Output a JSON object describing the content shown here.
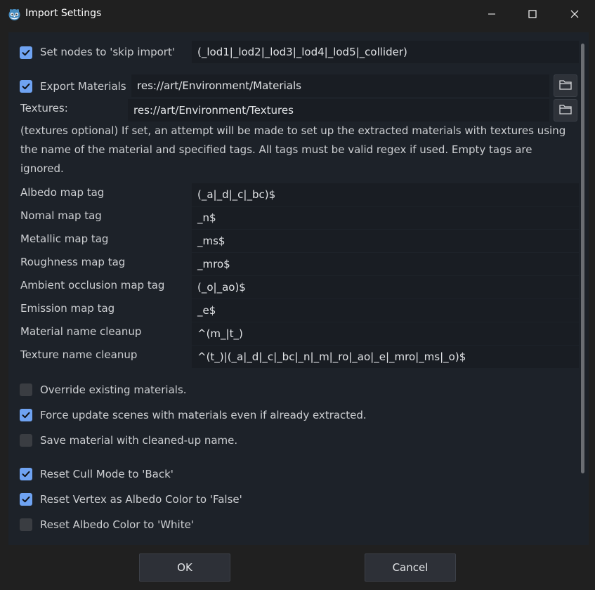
{
  "window": {
    "title": "Import Settings",
    "icon": "godot-icon",
    "controls": [
      "minimize-icon",
      "maximize-icon",
      "close-icon"
    ]
  },
  "skip_import": {
    "checked": true,
    "label": "Set nodes to 'skip import'",
    "value": "(_lod1|_lod2|_lod3|_lod4|_lod5|_collider)"
  },
  "export_materials": {
    "checked": true,
    "label": "Export Materials",
    "path": "res://art/Environment/Materials"
  },
  "textures": {
    "label": "Textures:",
    "path": "res://art/Environment/Textures"
  },
  "description": "(textures optional) If set, an attempt will be made to set up the extracted materials with textures using the name of the material and specified tags. All tags must be valid regex if used. Empty tags are ignored.",
  "tags": [
    {
      "label": "Albedo map tag",
      "value": "(_a|_d|_c|_bc)$"
    },
    {
      "label": "Nomal map tag",
      "value": "_n$"
    },
    {
      "label": "Metallic map tag",
      "value": "_ms$"
    },
    {
      "label": "Roughness map tag",
      "value": "_mro$"
    },
    {
      "label": "Ambient occlusion map tag",
      "value": "(_o|_ao)$"
    },
    {
      "label": "Emission map tag",
      "value": "_e$"
    },
    {
      "label": "Material name cleanup",
      "value": "^(m_|t_)"
    },
    {
      "label": "Texture name cleanup",
      "value": "^(t_)|(_a|_d|_c|_bc|_n|_m|_ro|_ao|_e|_mro|_ms|_o)$"
    }
  ],
  "options": [
    {
      "label": "Override existing materials.",
      "checked": false
    },
    {
      "label": "Force update scenes with materials even if already extracted.",
      "checked": true
    },
    {
      "label": "Save material with cleaned-up name.",
      "checked": false
    }
  ],
  "reset_options": [
    {
      "label": "Reset Cull Mode to 'Back'",
      "checked": true
    },
    {
      "label": "Reset Vertex as Albedo Color to 'False'",
      "checked": true
    },
    {
      "label": "Reset Albedo Color to 'White'",
      "checked": false
    }
  ],
  "buttons": {
    "ok": "OK",
    "cancel": "Cancel"
  },
  "colors": {
    "accent": "#6fa3f2",
    "panel": "#1d2229",
    "field": "#191d23",
    "window": "#202020"
  }
}
